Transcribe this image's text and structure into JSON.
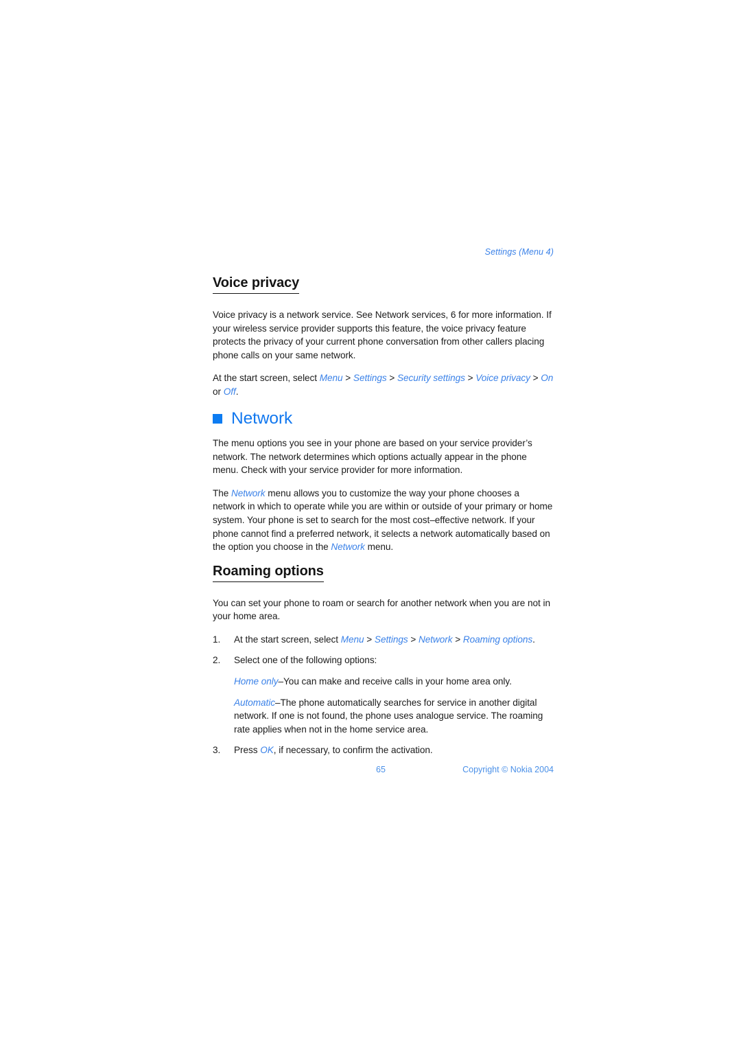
{
  "document": {
    "running_head": "Settings (Menu 4)",
    "page_number": "65",
    "copyright": "Copyright © Nokia 2004"
  },
  "voice_privacy": {
    "heading": "Voice privacy",
    "paragraph": "Voice privacy is a network service. See Network services, 6 for more information. If your wireless service provider supports this feature, the voice privacy feature protects the privacy of your current phone conversation from other callers placing phone calls on your same network.",
    "instruction": {
      "lead": "At the start screen, select ",
      "path": [
        "Menu",
        "Settings",
        "Security settings",
        "Voice privacy"
      ],
      "separator": " > ",
      "option_on": "On",
      "option_joiner": " or ",
      "option_off": "Off",
      "period": "."
    }
  },
  "network": {
    "heading": "Network",
    "bullet_icon": "filled-square-icon",
    "paragraph_1": "The menu options you see in your phone are based on your service provider’s network. The network determines which options actually appear in the phone menu. Check with your service provider for more information.",
    "paragraph_2": {
      "part_1": "The ",
      "emphasis_1": "Network",
      "part_2": " menu allows you to customize the way your phone chooses a network in which to operate while you are within or outside of your primary or home system. Your phone is set to search for the most cost–effective network. If your phone cannot find a preferred network, it selects a network automatically based on the option you choose in the ",
      "emphasis_2": "Network",
      "part_3": " menu."
    }
  },
  "roaming_options": {
    "heading": "Roaming options",
    "intro": "You can set your phone to roam or search for another network when you are not in your home area.",
    "steps": [
      {
        "number": "1.",
        "lead": "At the start screen, select ",
        "path": [
          "Menu",
          "Settings",
          "Network",
          "Roaming options"
        ],
        "separator": " > ",
        "trailing": "."
      },
      {
        "number": "2.",
        "text": "Select one of the following options:"
      },
      {
        "number": "3.",
        "lead": "Press ",
        "emphasis": "OK",
        "trailing": ", if necessary, to confirm the activation."
      }
    ],
    "options": [
      {
        "term": "Home only",
        "description": "–You can make and receive calls in your home area only."
      },
      {
        "term": "Automatic",
        "description": "–The phone automatically searches for service in another digital network. If one is not found, the phone uses analogue service. The roaming rate applies when not in the home service area."
      }
    ]
  },
  "colors": {
    "accent_blue": "#3b82e8",
    "heading_blue": "#1278ef",
    "bullet_blue": "#0d7cf2",
    "footer_blue": "#4a90e8",
    "text_black": "#1b1b1b"
  }
}
